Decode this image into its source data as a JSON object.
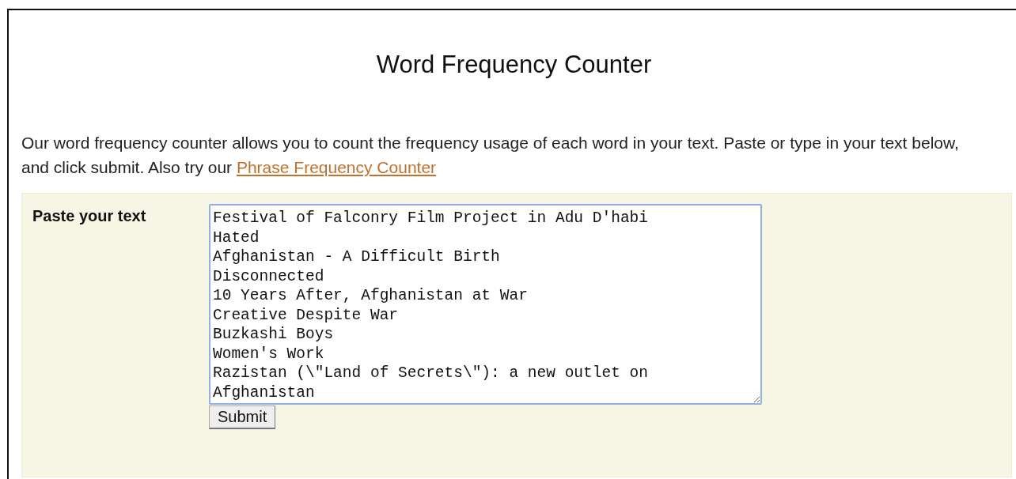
{
  "title": "Word Frequency Counter",
  "intro": {
    "text": "Our word frequency counter allows you to count the frequency usage of each word in your text. Paste or type in your text below, and click submit. Also try our ",
    "link": "Phrase Frequency Counter"
  },
  "form": {
    "label": "Paste your text",
    "text_lines": [
      "Festival of Falconry Film Project in Adu D'habi",
      "Hated",
      "Afghanistan - A Difficult Birth",
      "Disconnected",
      "10 Years After, Afghanistan at War",
      "Creative Despite War",
      "Buzkashi Boys",
      "Women's Work",
      "Razistan (\\\"Land of Secrets\\\"): a new outlet on Afghanistan"
    ],
    "submit": "Submit"
  }
}
